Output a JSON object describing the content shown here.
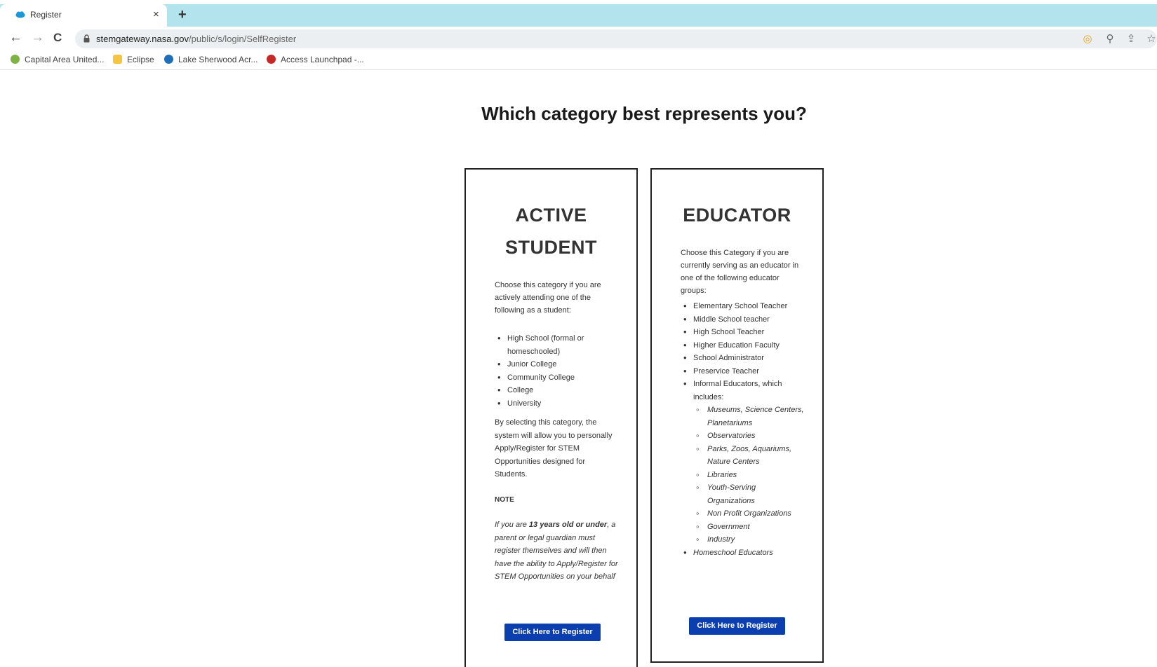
{
  "browser": {
    "tab": {
      "title": "Register",
      "close": "×"
    },
    "new_tab": "+",
    "nav": {
      "back": "←",
      "forward": "→",
      "reload": "C"
    },
    "url": {
      "host": "stemgateway.nasa.gov",
      "path": "/public/s/login/SelfRegister"
    },
    "bookmarks": [
      {
        "label": "Capital Area United...",
        "icon_color": "#7cb342",
        "icon": "capital-area-icon"
      },
      {
        "label": "Eclipse",
        "icon_color": "#f6c343",
        "icon": "folder-icon"
      },
      {
        "label": "Lake Sherwood Acr...",
        "icon_color": "#1e6fb8",
        "icon": "lake-sherwood-icon"
      },
      {
        "label": "Access Launchpad -...",
        "icon_color": "#c62828",
        "icon": "access-launchpad-icon"
      }
    ]
  },
  "page": {
    "title": "Which category best represents you?",
    "student": {
      "heading_line1": "ACTIVE",
      "heading_line2": "STUDENT",
      "intro": "Choose this category if you are actively attending one of the following as a student:",
      "items": [
        "High School (formal or homeschooled)",
        "Junior College",
        "Community College",
        "College",
        "University"
      ],
      "paragraph": "By selecting this category, the system will allow you to personally Apply/Register for STEM Opportunities designed for Students.",
      "note_label": "NOTE",
      "note_pre": "If you are ",
      "note_bold": "13 years old or under",
      "note_post": ", a parent or legal guardian must register themselves and will then have the ability to Apply/Register for STEM Opportunities on your behalf",
      "button": "Click Here to Register"
    },
    "educator": {
      "heading": "EDUCATOR",
      "intro": "Choose this Category if you are currently serving as an educator in one of the following educator groups:",
      "items": [
        "Elementary School Teacher",
        "Middle School teacher",
        "High School Teacher",
        "Higher Education Faculty",
        "School Administrator",
        "Preservice Teacher",
        "Informal Educators, which includes:"
      ],
      "sub_items": [
        "Museums, Science Centers, Planetariums",
        "Observatories",
        "Parks, Zoos, Aquariums, Nature Centers",
        "Libraries",
        "Youth-Serving Organizations",
        "Non Profit Organizations",
        "Government",
        "Industry"
      ],
      "last_item": "Homeschool Educators",
      "button": "Click Here to Register"
    }
  },
  "colors": {
    "tabstrip": "#b3e3ec",
    "button": "#0b3fb0",
    "border": "#222222"
  }
}
